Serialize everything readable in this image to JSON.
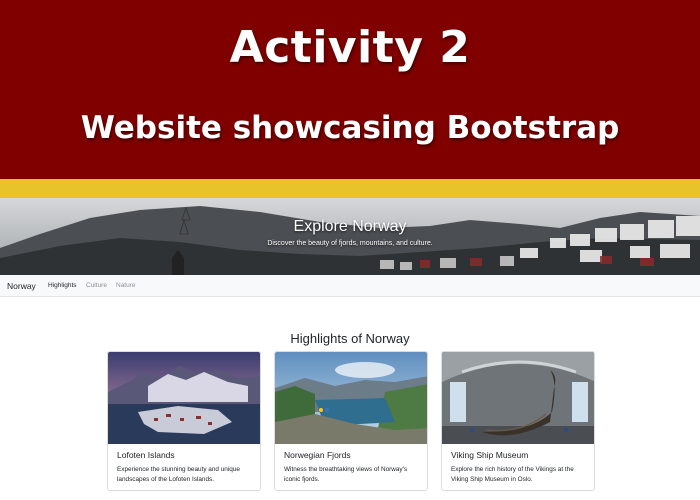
{
  "slide": {
    "title": "Activity 2",
    "subtitle": "Website showcasing Bootstrap",
    "colors": {
      "banner": "#800000",
      "stripe": "#e8c32a"
    }
  },
  "website": {
    "hero": {
      "title": "Explore Norway",
      "subtitle": "Discover the beauty of fjords, mountains, and culture."
    },
    "navbar": {
      "brand": "Norway",
      "links": [
        {
          "label": "Highlights",
          "active": true
        },
        {
          "label": "Culture",
          "active": false
        },
        {
          "label": "Nature",
          "active": false
        }
      ]
    },
    "section_title": "Highlights of Norway",
    "cards": [
      {
        "title": "Lofoten Islands",
        "text": "Experience the stunning beauty and unique landscapes of the Lofoten Islands.",
        "image": "lofoten-photo"
      },
      {
        "title": "Norwegian Fjords",
        "text": "Witness the breathtaking views of Norway's iconic fjords.",
        "image": "fjord-photo"
      },
      {
        "title": "Viking Ship Museum",
        "text": "Explore the rich history of the Vikings at the Viking Ship Museum in Oslo.",
        "image": "viking-ship-photo"
      }
    ]
  }
}
